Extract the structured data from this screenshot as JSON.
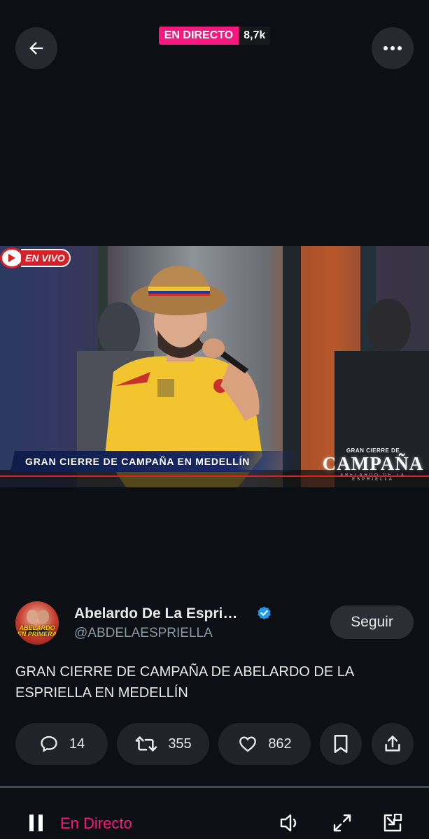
{
  "header": {
    "live_badge": "EN DIRECTO",
    "viewer_count": "8,7k"
  },
  "video": {
    "live_tag": "EN VIVO",
    "banner_text": "GRAN CIERRE DE CAMPAÑA EN MEDELLÍN",
    "logo_small": "GRAN CIERRE DE",
    "logo_big": "CAMPAÑA",
    "logo_sub": "ABELARDO DE LA ESPRIELLA"
  },
  "post": {
    "author_name": "Abelardo De La Espri…",
    "author_handle": "@ABDELAESPRIELLA",
    "avatar_text": "ABELARDO EN PRIMERA",
    "follow_label": "Seguir",
    "text": "GRAN CIERRE DE CAMPAÑA DE ABELARDO DE LA ESPRIELLA EN MEDELLÍN"
  },
  "actions": {
    "replies": "14",
    "reposts": "355",
    "likes": "862"
  },
  "player": {
    "status_label": "En Directo"
  },
  "colors": {
    "accent_pink": "#f91880",
    "verified_blue": "#1d9bf0",
    "background": "#0c0f13"
  }
}
